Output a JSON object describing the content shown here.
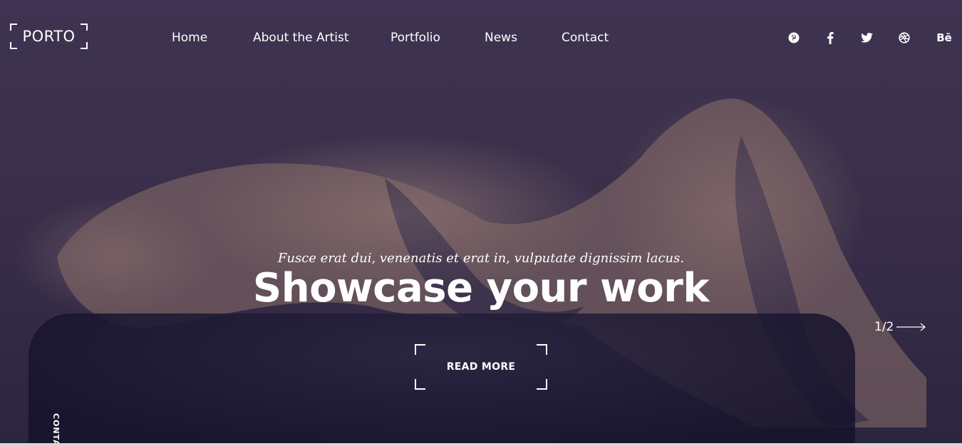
{
  "brand": {
    "logo_text": "PORTO"
  },
  "nav": {
    "items": [
      {
        "label": "Home"
      },
      {
        "label": "About the Artist"
      },
      {
        "label": "Portfolio"
      },
      {
        "label": "News"
      },
      {
        "label": "Contact"
      }
    ]
  },
  "social": {
    "icons": [
      "pinterest-icon",
      "facebook-icon",
      "twitter-icon",
      "dribbble-icon",
      "behance-icon"
    ],
    "behance_text": "Bē"
  },
  "hero": {
    "kicker": "Fusce erat dui, venenatis et erat in, vulputate dignissim lacus.",
    "headline": "Showcase your work",
    "cta_label": "READ MORE",
    "slide_counter": "1/2",
    "side_label": "CONTACT"
  },
  "colors": {
    "background": "#3a2f4a",
    "text": "#ffffff"
  }
}
